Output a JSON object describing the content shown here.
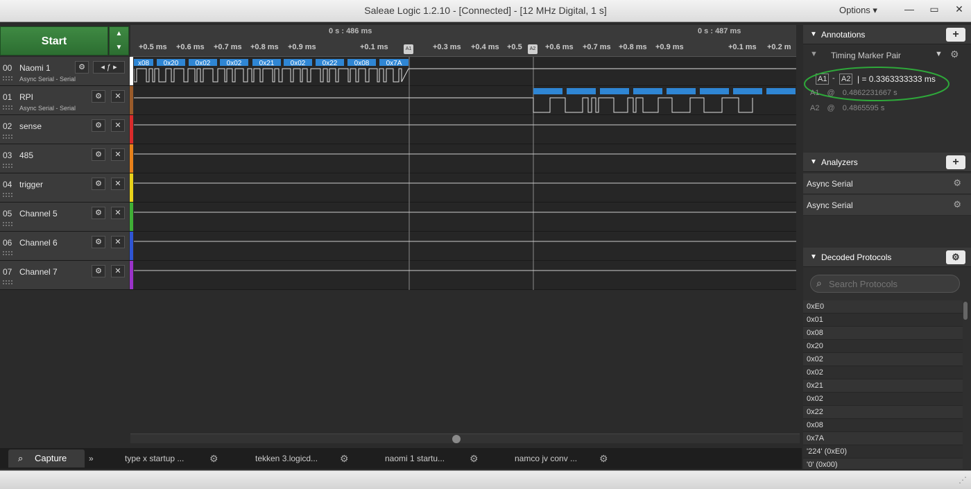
{
  "window": {
    "title": "Saleae Logic 1.2.10 - [Connected] - [12 MHz Digital, 1 s]",
    "options_label": "Options ▾",
    "minimize": "—",
    "maximize": "▭",
    "close": "✕"
  },
  "toolbar": {
    "start_label": "Start",
    "arrows": "▲\n▼"
  },
  "ruler": {
    "top_labels": [
      "0 s : 486 ms",
      "0 s : 487 ms"
    ],
    "ticks": [
      "+0.5 ms",
      "+0.6 ms",
      "+0.7 ms",
      "+0.8 ms",
      "+0.9 ms",
      "+0.1 ms",
      "+0.3 ms",
      "+0.4 ms",
      "+0.5",
      "+0.6 ms",
      "+0.7 ms",
      "+0.8 ms",
      "+0.9 ms",
      "+0.1 ms",
      "+0.2 m"
    ],
    "marker_a1": "A1",
    "marker_a2": "A2"
  },
  "channels": [
    {
      "num": "00",
      "name": "Naomi 1",
      "sub": "Async Serial - Serial",
      "color": "#ffffff"
    },
    {
      "num": "01",
      "name": "RPI",
      "sub": "Async Serial - Serial",
      "color": "#9a5b2a"
    },
    {
      "num": "02",
      "name": "sense",
      "sub": "",
      "color": "#d92b2b"
    },
    {
      "num": "03",
      "name": "485",
      "sub": "",
      "color": "#e8811a"
    },
    {
      "num": "04",
      "name": "trigger",
      "sub": "",
      "color": "#e8d21a"
    },
    {
      "num": "05",
      "name": "Channel 5",
      "sub": "",
      "color": "#3fae36"
    },
    {
      "num": "06",
      "name": "Channel 6",
      "sub": "",
      "color": "#2f55d4"
    },
    {
      "num": "07",
      "name": "Channel 7",
      "sub": "",
      "color": "#9a33c9"
    }
  ],
  "naomi_bytes": [
    "x08",
    "0x20",
    "0x02",
    "0x02",
    "0x21",
    "0x02",
    "0x22",
    "0x08",
    "0x7A"
  ],
  "tabs": {
    "capture": "Capture",
    "more": "»",
    "items": [
      "type x startup ...",
      "tekken 3.logicd...",
      "naomi 1 startu...",
      "namco jv conv ..."
    ]
  },
  "annotations": {
    "title": "Annotations",
    "marker_pair": "Timing Marker Pair",
    "diff_a1": "A1",
    "diff_a2": "A2",
    "diff_value": "| = 0.3363333333 ms",
    "a1_label": "A1",
    "a1_at": "@",
    "a1_value": "0.4862231667 s",
    "a2_label": "A2",
    "a2_at": "@",
    "a2_value": "0.4865595 s"
  },
  "analyzers": {
    "title": "Analyzers",
    "items": [
      "Async Serial",
      "Async Serial"
    ]
  },
  "decoded": {
    "title": "Decoded Protocols",
    "search_placeholder": "Search Protocols",
    "items": [
      "0xE0",
      "0x01",
      "0x08",
      "0x20",
      "0x02",
      "0x02",
      "0x21",
      "0x02",
      "0x22",
      "0x08",
      "0x7A",
      "'224' (0xE0)",
      "'0' (0x00)"
    ]
  }
}
